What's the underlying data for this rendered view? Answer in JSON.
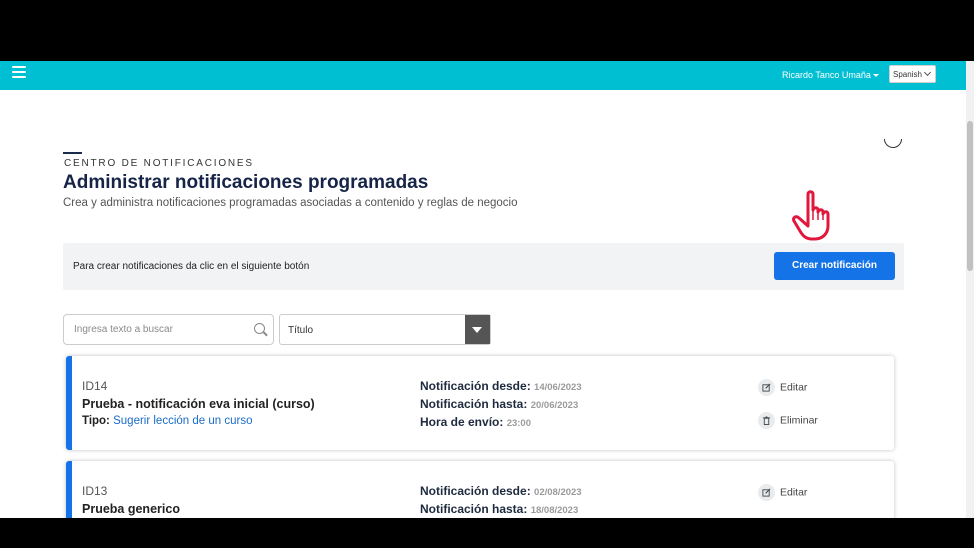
{
  "header": {
    "user_name": "Ricardo Tanco Umaña",
    "language": "Spanish"
  },
  "page": {
    "eyebrow": "CENTRO DE NOTIFICACIONES",
    "title": "Administrar notificaciones programadas",
    "subtitle": "Crea y administra notificaciones programadas asociadas a contenido y reglas de negocio"
  },
  "banner": {
    "text": "Para crear notificaciones da clic en el siguiente botón",
    "button_label": "Crear notificación"
  },
  "filters": {
    "search_placeholder": "Ingresa texto a buscar",
    "select_value": "Título"
  },
  "labels": {
    "tipo": "Tipo:",
    "desde": "Notificación desde:",
    "hasta": "Notificación hasta:",
    "hora": "Hora de envío:",
    "edit": "Editar",
    "delete": "Eliminar"
  },
  "notifications": [
    {
      "id": "ID14",
      "name": "Prueba - notificación eva inicial (curso)",
      "tipo": "Sugerir lección de un curso",
      "desde": "14/06/2023",
      "hasta": "20/06/2023",
      "hora": "23:00"
    },
    {
      "id": "ID13",
      "name": "Prueba generico",
      "desde": "02/08/2023",
      "hasta": "18/08/2023"
    }
  ],
  "colors": {
    "topbar": "#00bfd3",
    "primary": "#1473e6",
    "title": "#152447"
  }
}
